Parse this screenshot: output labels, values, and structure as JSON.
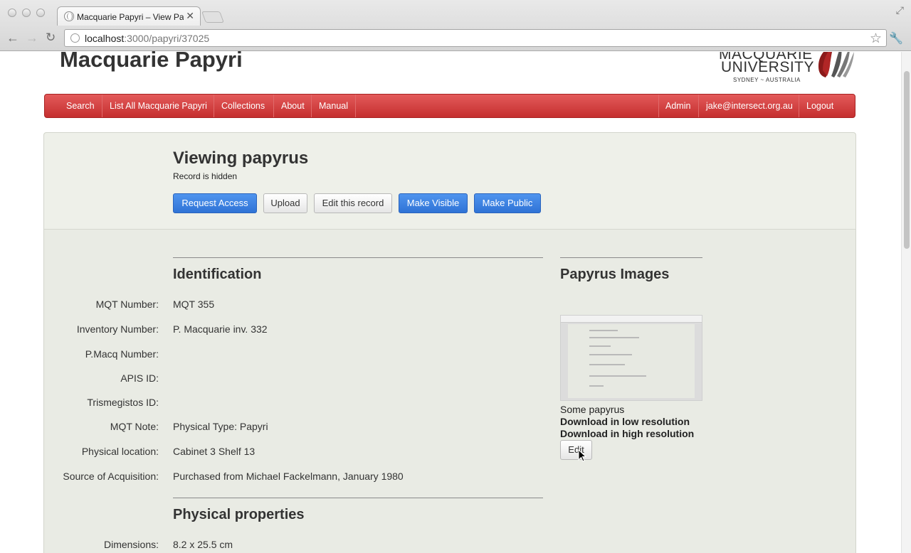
{
  "browser": {
    "tab_title": "Macquarie Papyri – View Papyrus",
    "url_host": "localhost",
    "url_path": ":3000/papyri/37025"
  },
  "site": {
    "title": "Macquarie Papyri",
    "logo_line1": "MACQUARIE",
    "logo_line2": "UNIVERSITY",
    "logo_line3": "SYDNEY ~ AUSTRALIA"
  },
  "nav": {
    "left": [
      "Search",
      "List All Macquarie Papyri",
      "Collections",
      "About",
      "Manual"
    ],
    "right": [
      "Admin",
      "jake@intersect.org.au",
      "Logout"
    ]
  },
  "header": {
    "title": "Viewing papyrus",
    "status": "Record is hidden",
    "buttons": {
      "request_access": "Request Access",
      "upload": "Upload",
      "edit_record": "Edit this record",
      "make_visible": "Make Visible",
      "make_public": "Make Public"
    }
  },
  "identification": {
    "heading": "Identification",
    "fields": [
      {
        "label": "MQT Number:",
        "value": "MQT 355"
      },
      {
        "label": "Inventory Number:",
        "value": "P. Macquarie inv. 332"
      },
      {
        "label": "P.Macq Number:",
        "value": ""
      },
      {
        "label": "APIS ID:",
        "value": ""
      },
      {
        "label": "Trismegistos ID:",
        "value": ""
      },
      {
        "label": "MQT Note:",
        "value": "Physical Type: Papyri"
      },
      {
        "label": "Physical location:",
        "value": "Cabinet 3 Shelf 13"
      },
      {
        "label": "Source of Acquisition:",
        "value": "Purchased from Michael Fackelmann, January 1980"
      }
    ]
  },
  "physical": {
    "heading": "Physical properties",
    "fields": [
      {
        "label": "Dimensions:",
        "value": "8.2 x 25.5 cm"
      }
    ]
  },
  "images": {
    "heading": "Papyrus Images",
    "caption": "Some papyrus",
    "low_res": "Download in low resolution",
    "high_res": "Download in high resolution",
    "edit": "Edit"
  },
  "colors": {
    "navbar": "#d03c3c",
    "primary_button": "#3a7fe0",
    "panel": "#e9ebe4"
  }
}
